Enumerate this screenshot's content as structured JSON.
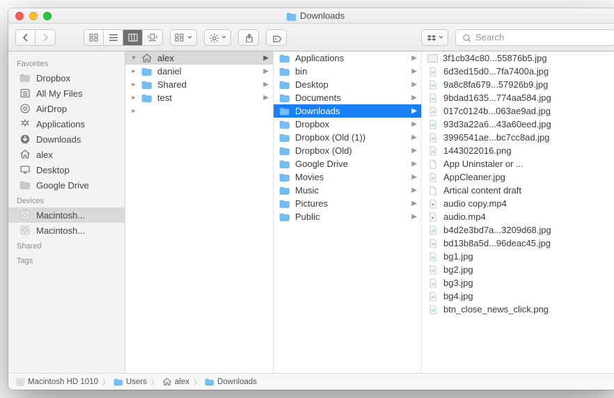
{
  "window": {
    "title": "Downloads"
  },
  "search": {
    "placeholder": "Search"
  },
  "sidebar": {
    "sections": [
      {
        "header": "Favorites",
        "items": [
          {
            "label": "Dropbox",
            "icon": "folder"
          },
          {
            "label": "All My Files",
            "icon": "allmyfiles"
          },
          {
            "label": "AirDrop",
            "icon": "airdrop"
          },
          {
            "label": "Applications",
            "icon": "applications"
          },
          {
            "label": "Downloads",
            "icon": "downloads"
          },
          {
            "label": "alex",
            "icon": "home"
          },
          {
            "label": "Desktop",
            "icon": "desktop"
          },
          {
            "label": "Google Drive",
            "icon": "folder"
          }
        ]
      },
      {
        "header": "Devices",
        "items": [
          {
            "label": "Macintosh...",
            "icon": "disk",
            "selected": true
          },
          {
            "label": "Macintosh...",
            "icon": "disk"
          }
        ]
      },
      {
        "header": "Shared",
        "items": []
      },
      {
        "header": "Tags",
        "items": []
      }
    ]
  },
  "columns": [
    {
      "items": [
        {
          "label": "alex",
          "icon": "home",
          "hasChildren": true,
          "hilite": true,
          "disclosure": "down"
        },
        {
          "label": "daniel",
          "icon": "folder",
          "hasChildren": true,
          "disclosure": "right"
        },
        {
          "label": "Shared",
          "icon": "folder",
          "hasChildren": true,
          "disclosure": "right"
        },
        {
          "label": "test",
          "icon": "folder",
          "hasChildren": true,
          "disclosure": "right"
        }
      ],
      "sparearrow": true
    },
    {
      "items": [
        {
          "label": "Applications",
          "icon": "folder",
          "hasChildren": true
        },
        {
          "label": "bin",
          "icon": "folder",
          "hasChildren": true
        },
        {
          "label": "Desktop",
          "icon": "folder",
          "hasChildren": true
        },
        {
          "label": "Documents",
          "icon": "folder",
          "hasChildren": true
        },
        {
          "label": "Downloads",
          "icon": "folder",
          "hasChildren": true,
          "selected": true
        },
        {
          "label": "Dropbox",
          "icon": "folder",
          "hasChildren": true
        },
        {
          "label": "Dropbox (Old (1))",
          "icon": "folder",
          "hasChildren": true
        },
        {
          "label": "Dropbox (Old)",
          "icon": "folder",
          "hasChildren": true
        },
        {
          "label": "Google Drive",
          "icon": "folder",
          "hasChildren": true
        },
        {
          "label": "Movies",
          "icon": "folder",
          "hasChildren": true
        },
        {
          "label": "Music",
          "icon": "folder",
          "hasChildren": true
        },
        {
          "label": "Pictures",
          "icon": "folder",
          "hasChildren": true
        },
        {
          "label": "Public",
          "icon": "folder",
          "hasChildren": true
        }
      ]
    },
    {
      "items": [
        {
          "label": "3f1cb34c80...55876b5.jpg",
          "icon": "thumb"
        },
        {
          "label": "6d3ed15d0...7fa7400a.jpg",
          "icon": "image"
        },
        {
          "label": "9a8c8fa679...57926b9.jpg",
          "icon": "image"
        },
        {
          "label": "9bdad1635...774aa584.jpg",
          "icon": "image"
        },
        {
          "label": "017c0124b...063ae9ad.jpg",
          "icon": "image"
        },
        {
          "label": "93d3a22a6...43a60eed.jpg",
          "icon": "image"
        },
        {
          "label": "3996541ae...bc7cc8ad.jpg",
          "icon": "image"
        },
        {
          "label": "1443022016.png",
          "icon": "image"
        },
        {
          "label": "App Uninstaler or ...",
          "icon": "doc"
        },
        {
          "label": "AppCleaner.jpg",
          "icon": "image"
        },
        {
          "label": "Artical content draft",
          "icon": "doc"
        },
        {
          "label": "audio copy.mp4",
          "icon": "media"
        },
        {
          "label": "audio.mp4",
          "icon": "media"
        },
        {
          "label": "b4d2e3bd7a...3209d68.jpg",
          "icon": "image"
        },
        {
          "label": "bd13b8a5d...96deac45.jpg",
          "icon": "image"
        },
        {
          "label": "bg1.jpg",
          "icon": "image"
        },
        {
          "label": "bg2.jpg",
          "icon": "image"
        },
        {
          "label": "bg3.jpg",
          "icon": "image"
        },
        {
          "label": "bg4.jpg",
          "icon": "image"
        },
        {
          "label": "btn_close_news_click.png",
          "icon": "image"
        }
      ]
    }
  ],
  "pathbar": [
    {
      "label": "Macintosh HD 1010",
      "icon": "disk"
    },
    {
      "label": "Users",
      "icon": "folder"
    },
    {
      "label": "alex",
      "icon": "home"
    },
    {
      "label": "Downloads",
      "icon": "folder"
    }
  ]
}
